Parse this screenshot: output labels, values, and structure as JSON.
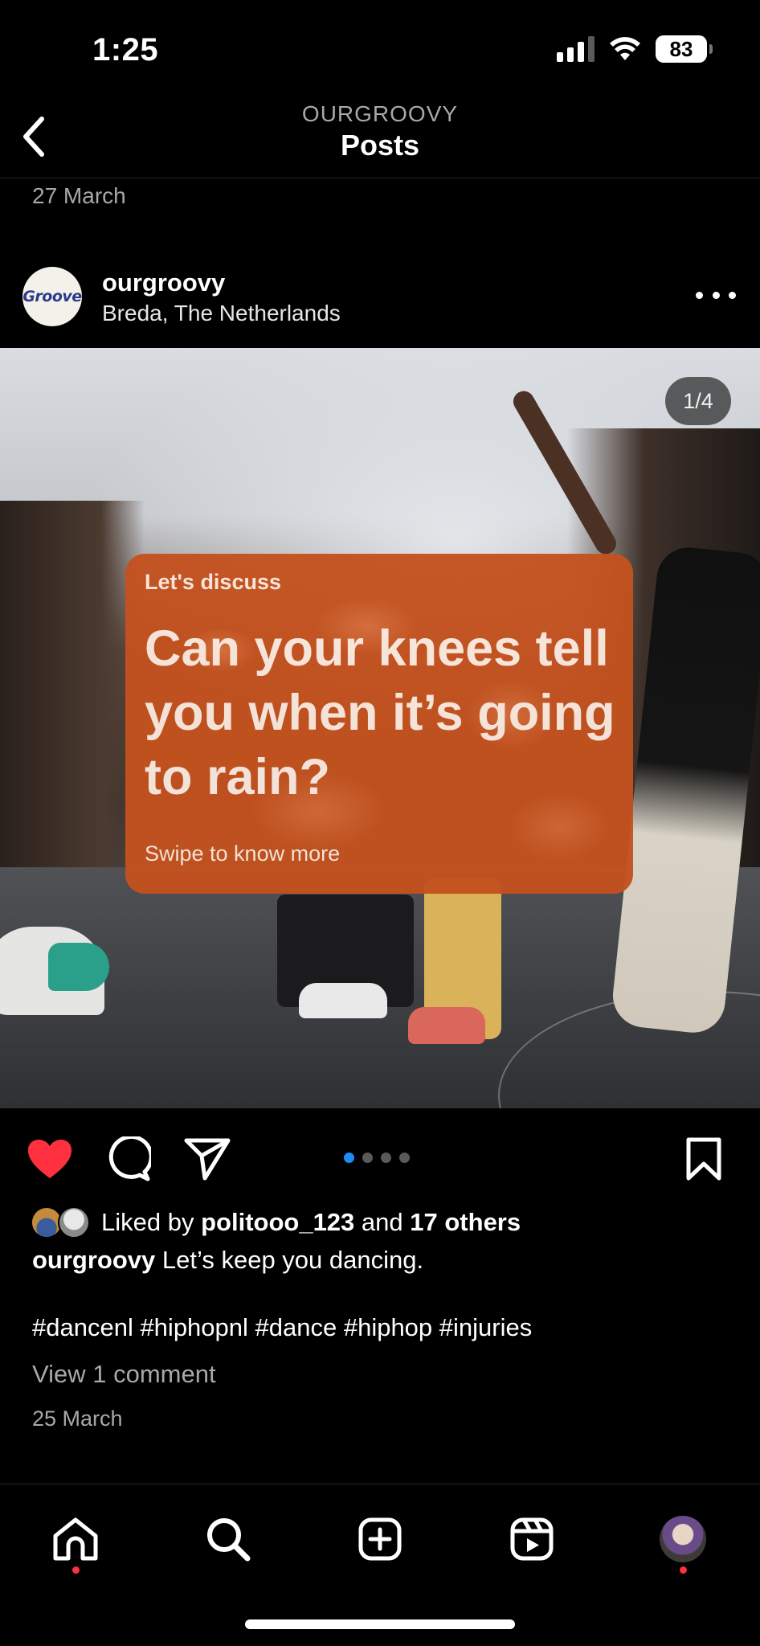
{
  "status_bar": {
    "time": "1:25",
    "battery": "83"
  },
  "header": {
    "subtitle": "OURGROOVY",
    "title": "Posts"
  },
  "previous_post": {
    "date": "27 March"
  },
  "post": {
    "avatar_logo_text": "Groove",
    "username": "ourgroovy",
    "location": "Breda, The Netherlands",
    "carousel": {
      "indicator": "1/4",
      "current": 1,
      "total": 4
    },
    "overlay": {
      "kicker": "Let's discuss",
      "headline": "Can your knees tell you when it’s going to rain?",
      "footer": "Swipe to know more"
    },
    "liked": true,
    "likes": {
      "prefix": "Liked by",
      "user": "politooo_123",
      "middle": "and",
      "others": "17 others"
    },
    "caption": {
      "username": "ourgroovy",
      "text": "Let’s keep you dancing."
    },
    "hashtags": "#dancenl #hiphopnl #dance #hiphop #injuries",
    "view_comments": "View 1 comment",
    "date": "25 March"
  },
  "icons": {
    "back": "chevron-left-icon",
    "more": "more-horizontal-icon",
    "like": "heart-filled-icon",
    "comment": "comment-icon",
    "share": "paper-plane-icon",
    "save": "bookmark-icon",
    "tabs": [
      "home-icon",
      "search-icon",
      "create-icon",
      "reels-icon",
      "profile-avatar"
    ]
  },
  "colors": {
    "like": "#ff3040",
    "active_dot": "#1d8cf5",
    "card": "#c4521f",
    "notification_dot": "#ff3040"
  }
}
